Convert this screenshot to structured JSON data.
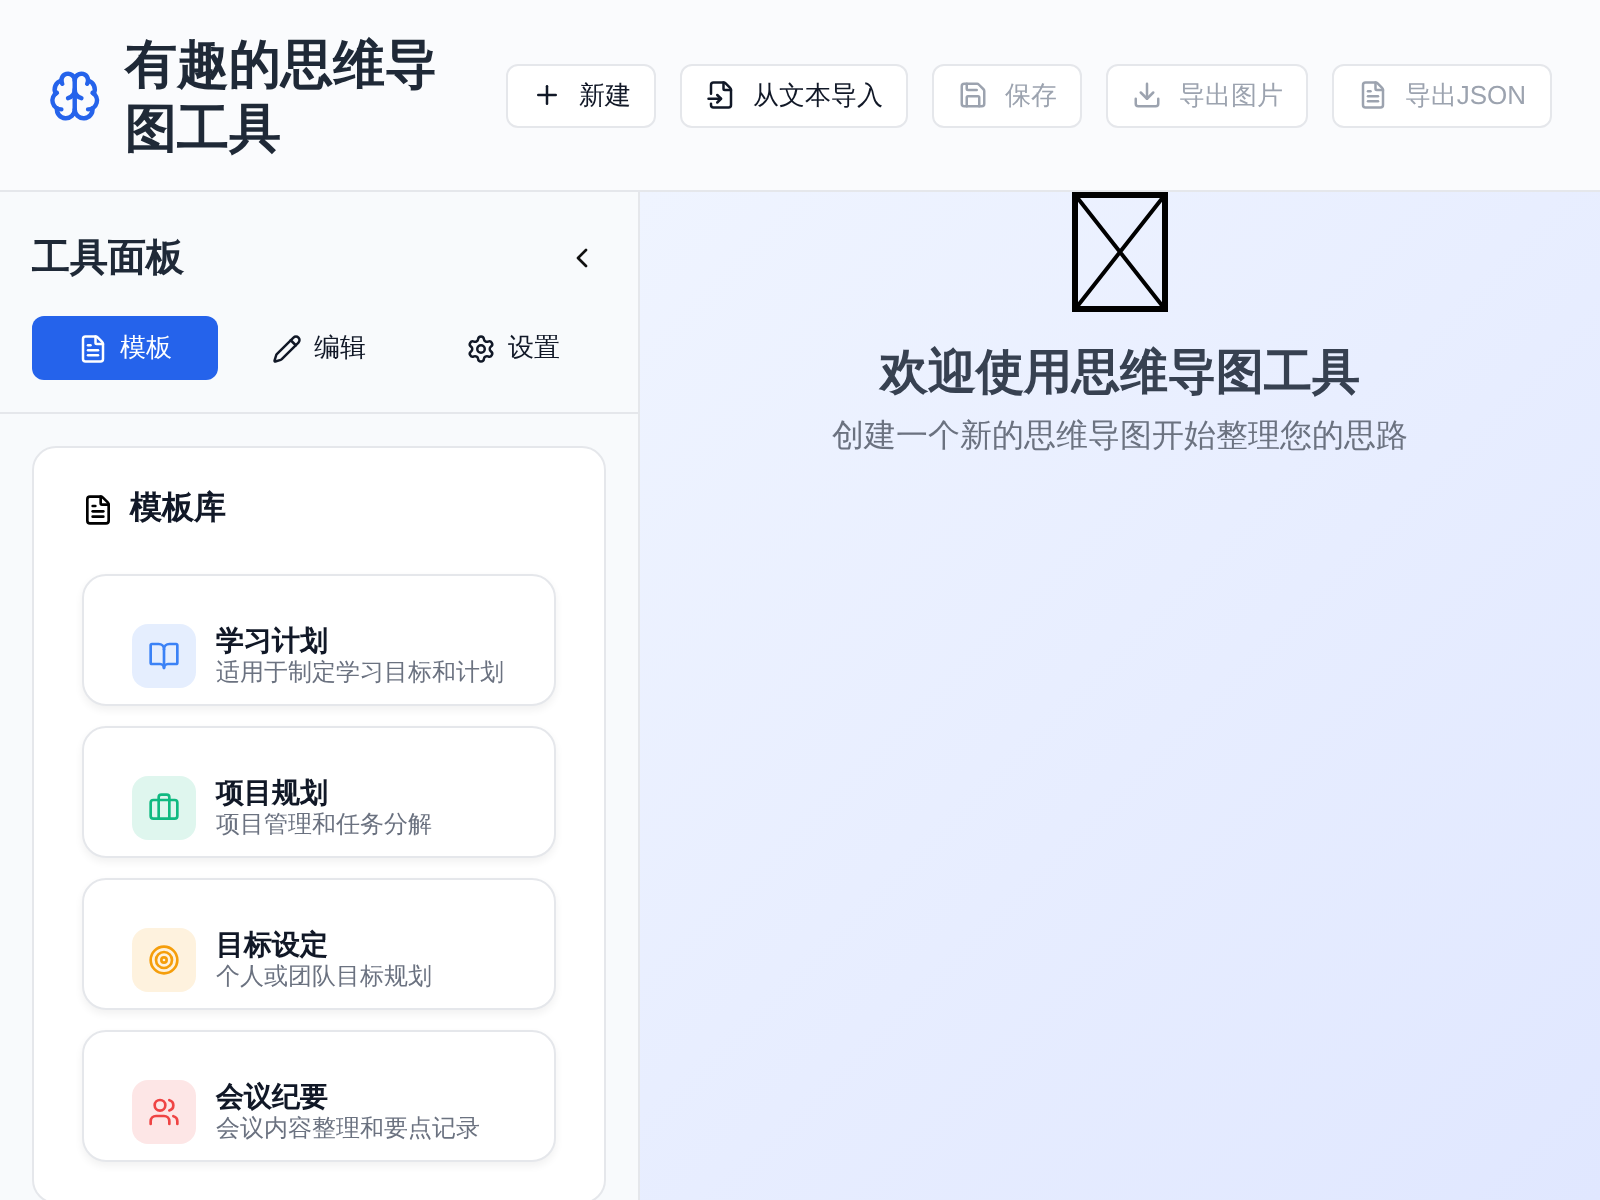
{
  "header": {
    "title": "有趣的思维导图工具",
    "actions": [
      {
        "label": "新建",
        "disabled": false
      },
      {
        "label": "从文本导入",
        "disabled": false
      },
      {
        "label": "保存",
        "disabled": true
      },
      {
        "label": "导出图片",
        "disabled": true
      },
      {
        "label": "导出JSON",
        "disabled": true
      }
    ]
  },
  "sidebar": {
    "title": "工具面板",
    "tabs": [
      {
        "label": "模板",
        "selected": true
      },
      {
        "label": "编辑",
        "selected": false
      },
      {
        "label": "设置",
        "selected": false
      }
    ],
    "library": {
      "title": "模板库",
      "templates": [
        {
          "name": "学习计划",
          "description": "适用于制定学习目标和计划",
          "color": "#3b82f6"
        },
        {
          "name": "项目规划",
          "description": "项目管理和任务分解",
          "color": "#10b981"
        },
        {
          "name": "目标设定",
          "description": "个人或团队目标规划",
          "color": "#f59e0b"
        },
        {
          "name": "会议纪要",
          "description": "会议内容整理和要点记录",
          "color": "#ef4444"
        }
      ]
    }
  },
  "welcome": {
    "title": "欢迎使用思维导图工具",
    "subtitle": "创建一个新的思维导图开始整理您的思路"
  }
}
